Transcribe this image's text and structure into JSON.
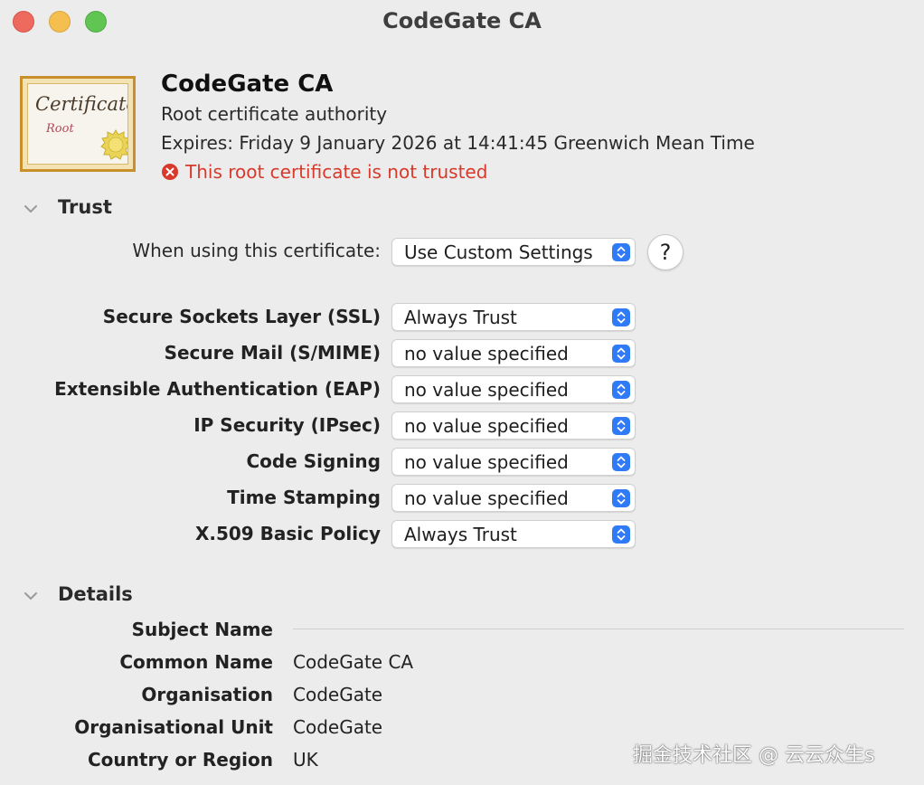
{
  "window": {
    "title": "CodeGate CA"
  },
  "header": {
    "cert_icon": "certificate-icon",
    "cert_icon_word": "Certificate",
    "cert_icon_sub": "Root",
    "name": "CodeGate CA",
    "kind": "Root certificate authority",
    "expires": "Expires: Friday 9 January 2026 at 14:41:45 Greenwich Mean Time",
    "warning": "This root certificate is not trusted",
    "warning_color": "#d9392b"
  },
  "trust": {
    "section_label": "Trust",
    "when_using_label": "When using this certificate:",
    "when_using_value": "Use Custom Settings",
    "help_label": "?",
    "policies": [
      {
        "label": "Secure Sockets Layer (SSL)",
        "value": "Always Trust"
      },
      {
        "label": "Secure Mail (S/MIME)",
        "value": "no value specified"
      },
      {
        "label": "Extensible Authentication (EAP)",
        "value": "no value specified"
      },
      {
        "label": "IP Security (IPsec)",
        "value": "no value specified"
      },
      {
        "label": "Code Signing",
        "value": "no value specified"
      },
      {
        "label": "Time Stamping",
        "value": "no value specified"
      },
      {
        "label": "X.509 Basic Policy",
        "value": "Always Trust"
      }
    ]
  },
  "details": {
    "section_label": "Details",
    "subject_name_label": "Subject Name",
    "rows": [
      {
        "label": "Common Name",
        "value": "CodeGate CA"
      },
      {
        "label": "Organisation",
        "value": "CodeGate"
      },
      {
        "label": "Organisational Unit",
        "value": "CodeGate"
      },
      {
        "label": "Country or Region",
        "value": "UK"
      }
    ]
  },
  "watermark": "掘金技术社区 @ 云云众生s",
  "colors": {
    "accent": "#2f7bf6",
    "close": "#ed6a5e",
    "minimize": "#f5bf4f",
    "zoom": "#61c554"
  }
}
